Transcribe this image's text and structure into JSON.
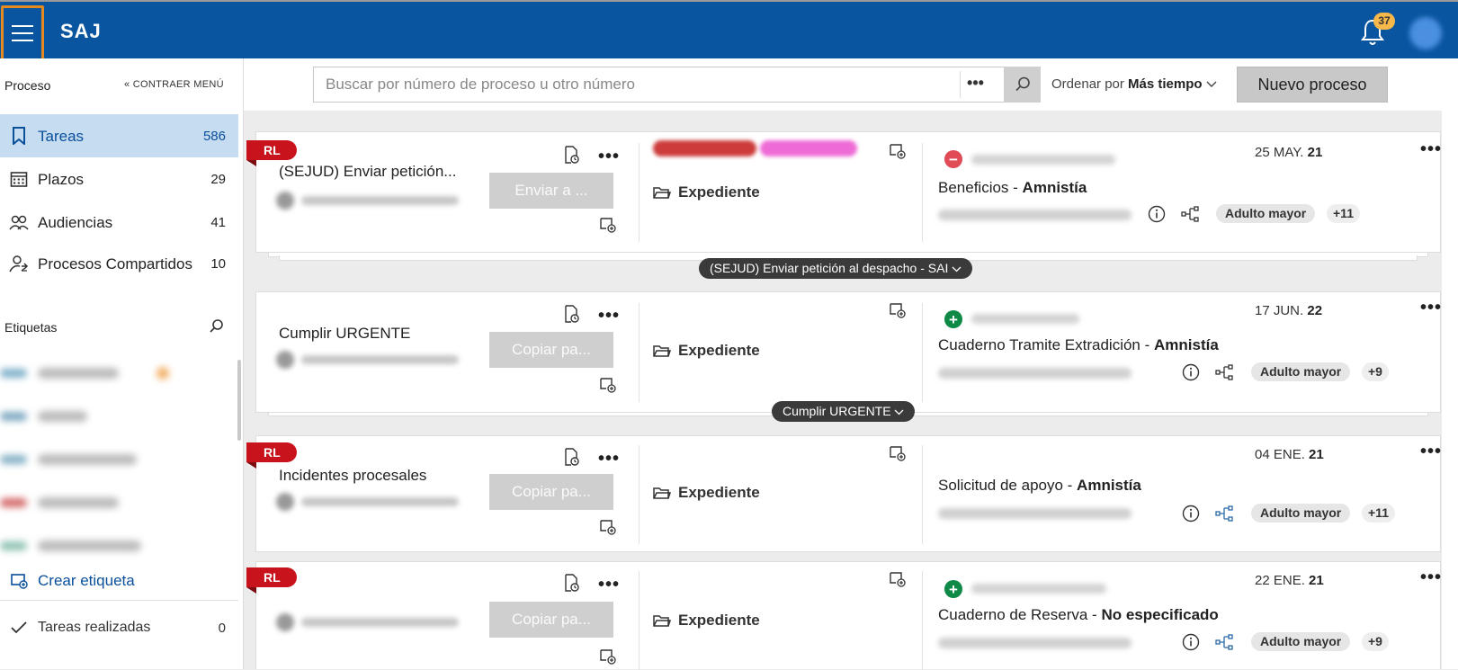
{
  "app": {
    "brand": "SAJ",
    "notifications_count": "37"
  },
  "sidebar": {
    "section_title": "Proceso",
    "collapse_label": "« CONTRAER MENÚ",
    "items": [
      {
        "label": "Tareas",
        "count": "586",
        "icon": "bookmark-icon",
        "active": true
      },
      {
        "label": "Plazos",
        "count": "29",
        "icon": "calendar-icon"
      },
      {
        "label": "Audiencias",
        "count": "41",
        "icon": "people-icon"
      },
      {
        "label": "Procesos Compartidos",
        "count": "10",
        "icon": "shared-user-icon"
      }
    ],
    "labels_title": "Etiquetas",
    "create_label": "Crear etiqueta",
    "done_label": "Tareas realizadas",
    "done_count": "0"
  },
  "toolbar": {
    "search_placeholder": "Buscar por número de proceso u otro número",
    "more_label": "•••",
    "sort_prefix": "Ordenar por",
    "sort_value": "Más tiempo",
    "new_button": "Nuevo proceso"
  },
  "cards": [
    {
      "badge": "RL",
      "title": "(SEJUD) Enviar petición...",
      "button": "Enviar a ...",
      "expediente": "Expediente",
      "date_day": "25 MAY.",
      "date_year": "21",
      "proc_type": "Beneficios",
      "proc_sep": " - ",
      "proc_sub": "Amnistía",
      "tag": "Adulto mayor",
      "more_tags": "+11",
      "status": "minus",
      "chip": "(SEJUD) Enviar petición al despacho - SAI"
    },
    {
      "badge": "",
      "title": "Cumplir URGENTE",
      "button": "Copiar pa...",
      "expediente": "Expediente",
      "date_day": "17 JUN.",
      "date_year": "22",
      "proc_type": "Cuaderno Tramite Extradición",
      "proc_sep": " - ",
      "proc_sub": "Amnistía",
      "tag": "Adulto mayor",
      "more_tags": "+9",
      "status": "plus",
      "chip": "Cumplir URGENTE"
    },
    {
      "badge": "RL",
      "title": "Incidentes procesales",
      "button": "Copiar pa...",
      "expediente": "Expediente",
      "date_day": "04 ENE.",
      "date_year": "21",
      "proc_type": "Solicitud de apoyo",
      "proc_sep": " - ",
      "proc_sub": "Amnistía",
      "tag": "Adulto mayor",
      "more_tags": "+11",
      "status": ""
    },
    {
      "badge": "RL",
      "title": "",
      "button": "Copiar pa...",
      "expediente": "Expediente",
      "date_day": "22 ENE.",
      "date_year": "21",
      "proc_type": "Cuaderno de Reserva",
      "proc_sep": " - ",
      "proc_sub": "No especificado",
      "tag": "Adulto mayor",
      "more_tags": "+9",
      "status": "plus"
    }
  ],
  "colors": {
    "header": "#0a55a0",
    "accent": "#0a4f9a",
    "rl_badge": "#c9131c",
    "hamburger_focus": "#e58a1f"
  }
}
